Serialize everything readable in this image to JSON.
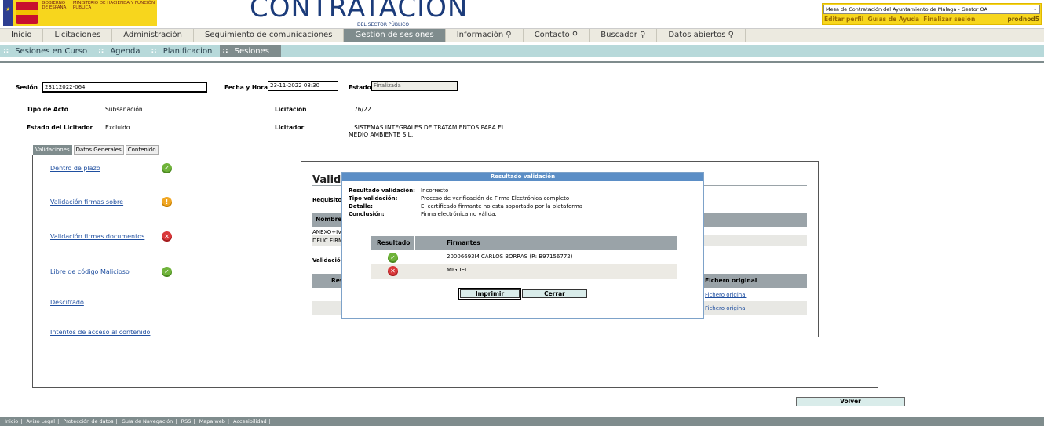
{
  "header": {
    "gov_text_1": "GOBIERNO DE ESPAÑA",
    "gov_text_2": "MINISTERIO DE HACIENDA Y FUNCIÓN PÚBLICA",
    "site_title": "CONTRATACIÓN",
    "site_subtitle": "DEL SECTOR PÚBLICO",
    "org_select_value": "Mesa de Contratación del Ayuntamiento de Málaga - Gestor OA",
    "user_links": [
      "Editar perfil",
      "Guías de Ayuda",
      "Finalizar sesión"
    ],
    "username": "prodnod5"
  },
  "nav": {
    "items": [
      "Inicio",
      "Licitaciones",
      "Administración",
      "Seguimiento de comunicaciones",
      "Gestión de sesiones",
      "Información",
      "Contacto",
      "Buscador",
      "Datos abiertos"
    ],
    "active": "Gestión de sesiones"
  },
  "subnav": {
    "items": [
      "Sesiones en Curso",
      "Agenda",
      "Planificacion",
      "Sesiones"
    ],
    "active": "Sesiones"
  },
  "session": {
    "sesion_label": "Sesión",
    "sesion_value": "23112022-064",
    "fecha_label": "Fecha y Hora",
    "fecha_value": "23-11-2022 08:30",
    "estado_label": "Estado",
    "estado_value": "Finalizada",
    "tipo_acto_label": "Tipo de Acto",
    "tipo_acto_value": "Subsanación",
    "licitacion_label": "Licitación",
    "licitacion_value": "76/22",
    "estado_licitador_label": "Estado del Licitador",
    "estado_licitador_value": "Excluido",
    "licitador_label": "Licitador",
    "licitador_value_1": "SISTEMAS INTEGRALES DE TRATAMIENTOS PARA EL",
    "licitador_value_2": "MEDIO AMBIENTE S.L."
  },
  "tabs": [
    "Validaciones",
    "Datos Generales",
    "Contenido"
  ],
  "validations": [
    {
      "label": "Dentro de plazo",
      "status": "ok"
    },
    {
      "label": "Validación firmas sobre",
      "status": "warn"
    },
    {
      "label": "Validación firmas documentos",
      "status": "error"
    },
    {
      "label": "Libre de código Malicioso",
      "status": "ok"
    },
    {
      "label": "Descifrado",
      "status": ""
    },
    {
      "label": "Intentos de acceso al contenido",
      "status": ""
    }
  ],
  "inner_panel": {
    "title": "Validac",
    "requisitos": "Requisito",
    "nombre_header": "Nombre",
    "row1": "ANEXO+IV",
    "row2": "DEUC FIRM",
    "validacion_label": "Validació",
    "res_header": "Res",
    "fichero_header": "Fichero original",
    "fichero_link_1": "Fichero original",
    "fichero_link_2": "Fichero original"
  },
  "modal": {
    "title": "Resultado validación",
    "resultado_label": "Resultado validación:",
    "resultado_value": "Incorrecto",
    "tipo_label": "Tipo validación:",
    "tipo_value": "Proceso de verificación de Firma Electrónica completo",
    "detalle_label": "Detalle:",
    "detalle_value": "El certificado firmante no esta soportado por la plataforma",
    "conclusion_label": "Conclusión:",
    "conclusion_value": "Firma electrónica no válida.",
    "table_headers": [
      "Resultado",
      "Firmantes"
    ],
    "rows": [
      {
        "status": "ok",
        "firmante": "20006693M CARLOS BORRAS (R: B97156772)"
      },
      {
        "status": "error",
        "firmante": "MIGUEL"
      }
    ],
    "imprimir_label": "Imprimir",
    "cerrar_label": "Cerrar"
  },
  "volver_label": "Volver",
  "footer": {
    "links": [
      "Inicio",
      "Aviso Legal",
      "Protección de datos",
      "Guía de Navegación",
      "RSS",
      "Mapa web",
      "Accesibilidad"
    ]
  },
  "colors": {
    "accent_yellow": "#f7d61d",
    "nav_active": "#7f8c8d",
    "subnav_bg": "#b7d9da",
    "modal_title": "#5b8ec6"
  }
}
